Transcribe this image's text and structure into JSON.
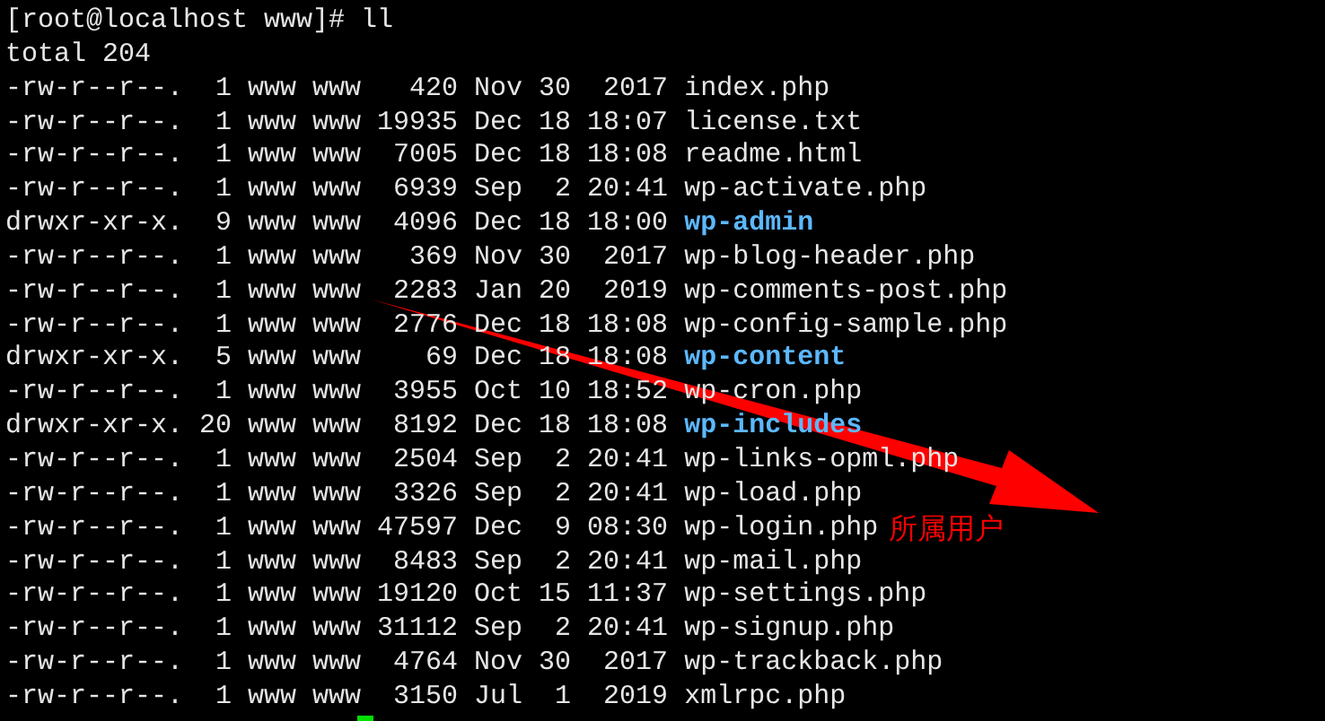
{
  "terminal": {
    "lines": [
      {
        "kind": "prompt",
        "text": "[root@localhost www]# ll"
      },
      {
        "kind": "total",
        "text": "total 204"
      },
      {
        "kind": "entry",
        "meta": "-rw-r--r--.  1 www www   420 Nov 30  2017",
        "name": "index.php",
        "is_dir": false
      },
      {
        "kind": "entry",
        "meta": "-rw-r--r--.  1 www www 19935 Dec 18 18:07",
        "name": "license.txt",
        "is_dir": false
      },
      {
        "kind": "entry",
        "meta": "-rw-r--r--.  1 www www  7005 Dec 18 18:08",
        "name": "readme.html",
        "is_dir": false
      },
      {
        "kind": "entry",
        "meta": "-rw-r--r--.  1 www www  6939 Sep  2 20:41",
        "name": "wp-activate.php",
        "is_dir": false
      },
      {
        "kind": "entry",
        "meta": "drwxr-xr-x.  9 www www  4096 Dec 18 18:00",
        "name": "wp-admin",
        "is_dir": true
      },
      {
        "kind": "entry",
        "meta": "-rw-r--r--.  1 www www   369 Nov 30  2017",
        "name": "wp-blog-header.php",
        "is_dir": false
      },
      {
        "kind": "entry",
        "meta": "-rw-r--r--.  1 www www  2283 Jan 20  2019",
        "name": "wp-comments-post.php",
        "is_dir": false
      },
      {
        "kind": "entry",
        "meta": "-rw-r--r--.  1 www www  2776 Dec 18 18:08",
        "name": "wp-config-sample.php",
        "is_dir": false
      },
      {
        "kind": "entry",
        "meta": "drwxr-xr-x.  5 www www    69 Dec 18 18:08",
        "name": "wp-content",
        "is_dir": true
      },
      {
        "kind": "entry",
        "meta": "-rw-r--r--.  1 www www  3955 Oct 10 18:52",
        "name": "wp-cron.php",
        "is_dir": false
      },
      {
        "kind": "entry",
        "meta": "drwxr-xr-x. 20 www www  8192 Dec 18 18:08",
        "name": "wp-includes",
        "is_dir": true
      },
      {
        "kind": "entry",
        "meta": "-rw-r--r--.  1 www www  2504 Sep  2 20:41",
        "name": "wp-links-opml.php",
        "is_dir": false
      },
      {
        "kind": "entry",
        "meta": "-rw-r--r--.  1 www www  3326 Sep  2 20:41",
        "name": "wp-load.php",
        "is_dir": false
      },
      {
        "kind": "entry",
        "meta": "-rw-r--r--.  1 www www 47597 Dec  9 08:30",
        "name": "wp-login.php",
        "is_dir": false
      },
      {
        "kind": "entry",
        "meta": "-rw-r--r--.  1 www www  8483 Sep  2 20:41",
        "name": "wp-mail.php",
        "is_dir": false
      },
      {
        "kind": "entry",
        "meta": "-rw-r--r--.  1 www www 19120 Oct 15 11:37",
        "name": "wp-settings.php",
        "is_dir": false
      },
      {
        "kind": "entry",
        "meta": "-rw-r--r--.  1 www www 31112 Sep  2 20:41",
        "name": "wp-signup.php",
        "is_dir": false
      },
      {
        "kind": "entry",
        "meta": "-rw-r--r--.  1 www www  4764 Nov 30  2017",
        "name": "wp-trackback.php",
        "is_dir": false
      },
      {
        "kind": "entry",
        "meta": "-rw-r--r--.  1 www www  3150 Jul  1  2019",
        "name": "xmlrpc.php",
        "is_dir": false
      },
      {
        "kind": "cursor"
      }
    ]
  },
  "annotation": {
    "text": "所属用户"
  }
}
